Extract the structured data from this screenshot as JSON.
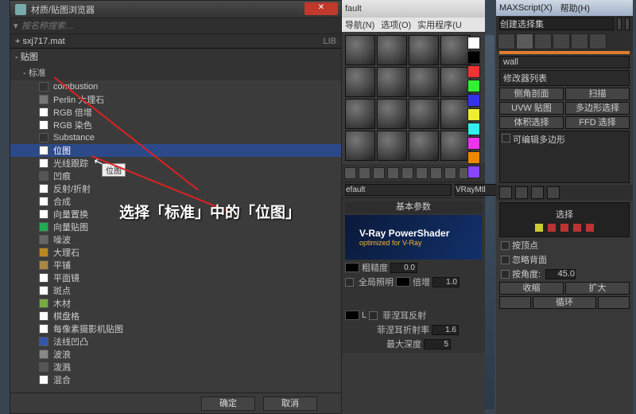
{
  "browser": {
    "title": "材质/贴图浏览器",
    "search_placeholder": "按名称搜索…",
    "path": "+ sxj717.mat",
    "path_tag": "LIB",
    "group_maps": "- 贴图",
    "group_standard": "- 标准",
    "items": [
      {
        "label": "combustion",
        "sw": "#333"
      },
      {
        "label": "Perlin 大理石",
        "sw": "#777"
      },
      {
        "label": "RGB 倍增",
        "sw": "#fff"
      },
      {
        "label": "RGB 染色",
        "sw": "#fff"
      },
      {
        "label": "Substance",
        "sw": "#333"
      },
      {
        "label": "位图",
        "sw": "#fff",
        "selected": true
      },
      {
        "label": "光线跟踪",
        "sw": "#fff"
      },
      {
        "label": "凹痕",
        "sw": "#555"
      },
      {
        "label": "反射/折射",
        "sw": "#fff"
      },
      {
        "label": "合成",
        "sw": "#fff"
      },
      {
        "label": "向量置换",
        "sw": "#fff"
      },
      {
        "label": "向量贴图",
        "sw": "#2a5"
      },
      {
        "label": "噪波",
        "sw": "#666"
      },
      {
        "label": "大理石",
        "sw": "#b82"
      },
      {
        "label": "平铺",
        "sw": "#a84"
      },
      {
        "label": "平面镜",
        "sw": "#fff"
      },
      {
        "label": "斑点",
        "sw": "#fff"
      },
      {
        "label": "木材",
        "sw": "#7a4"
      },
      {
        "label": "棋盘格",
        "sw": "#fff"
      },
      {
        "label": "每像素摄影机贴图",
        "sw": "#fff"
      },
      {
        "label": "法线凹凸",
        "sw": "#35a"
      },
      {
        "label": "波浪",
        "sw": "#888"
      },
      {
        "label": "泼溅",
        "sw": "#555"
      },
      {
        "label": "混合",
        "sw": "#fff"
      }
    ],
    "ok": "确定",
    "cancel": "取消",
    "tooltip": "位图"
  },
  "annotation": "选择「标准」中的「位图」",
  "mateditor": {
    "title": "fault",
    "menus": [
      "导航(N)",
      "选项(O)",
      "实用程序(U"
    ],
    "dropdown_left": "efault",
    "dropdown_right": "VRayMtl",
    "roll_basic": "基本参数",
    "vray_brand": "V-Ray PowerShader",
    "vray_sub": "optimized for V-Ray",
    "rough_lbl": "粗糙度",
    "rough_val": "0.0",
    "gi_lbl": "全局照明",
    "mult_lbl": "倍增",
    "mult_val": "1.0",
    "fresnel_lbl": "菲涅耳反射",
    "fresnel_ior_lbl": "菲涅耳折射率",
    "fresnel_ior_val": "1.6",
    "maxdepth_lbl": "最大深度",
    "maxdepth_val": "5",
    "l_label": "L"
  },
  "cmdpanel": {
    "menu": [
      "MAXScript(X)",
      "帮助(H)"
    ],
    "dropdown": "创建选择集",
    "name": "wall",
    "modlist": "修改器列表",
    "btns": [
      [
        "侧角剖面",
        "扫描"
      ],
      [
        "UVW 贴图",
        "多边形选择"
      ],
      [
        "体积选择",
        "FFD 选择"
      ]
    ],
    "stack_item": "可编辑多边形",
    "sel_title": "选择",
    "chk_vertex": "按顶点",
    "chk_ignore": "忽略背面",
    "angle_lbl": "按角度:",
    "angle_val": "45.0",
    "shrink": "收缩",
    "grow": "扩大",
    "ring": "循环"
  },
  "swatches": [
    "#fff",
    "#000",
    "#e33",
    "#3e3",
    "#33e",
    "#ee3",
    "#3ee",
    "#e3e",
    "#e80",
    "#84f"
  ]
}
